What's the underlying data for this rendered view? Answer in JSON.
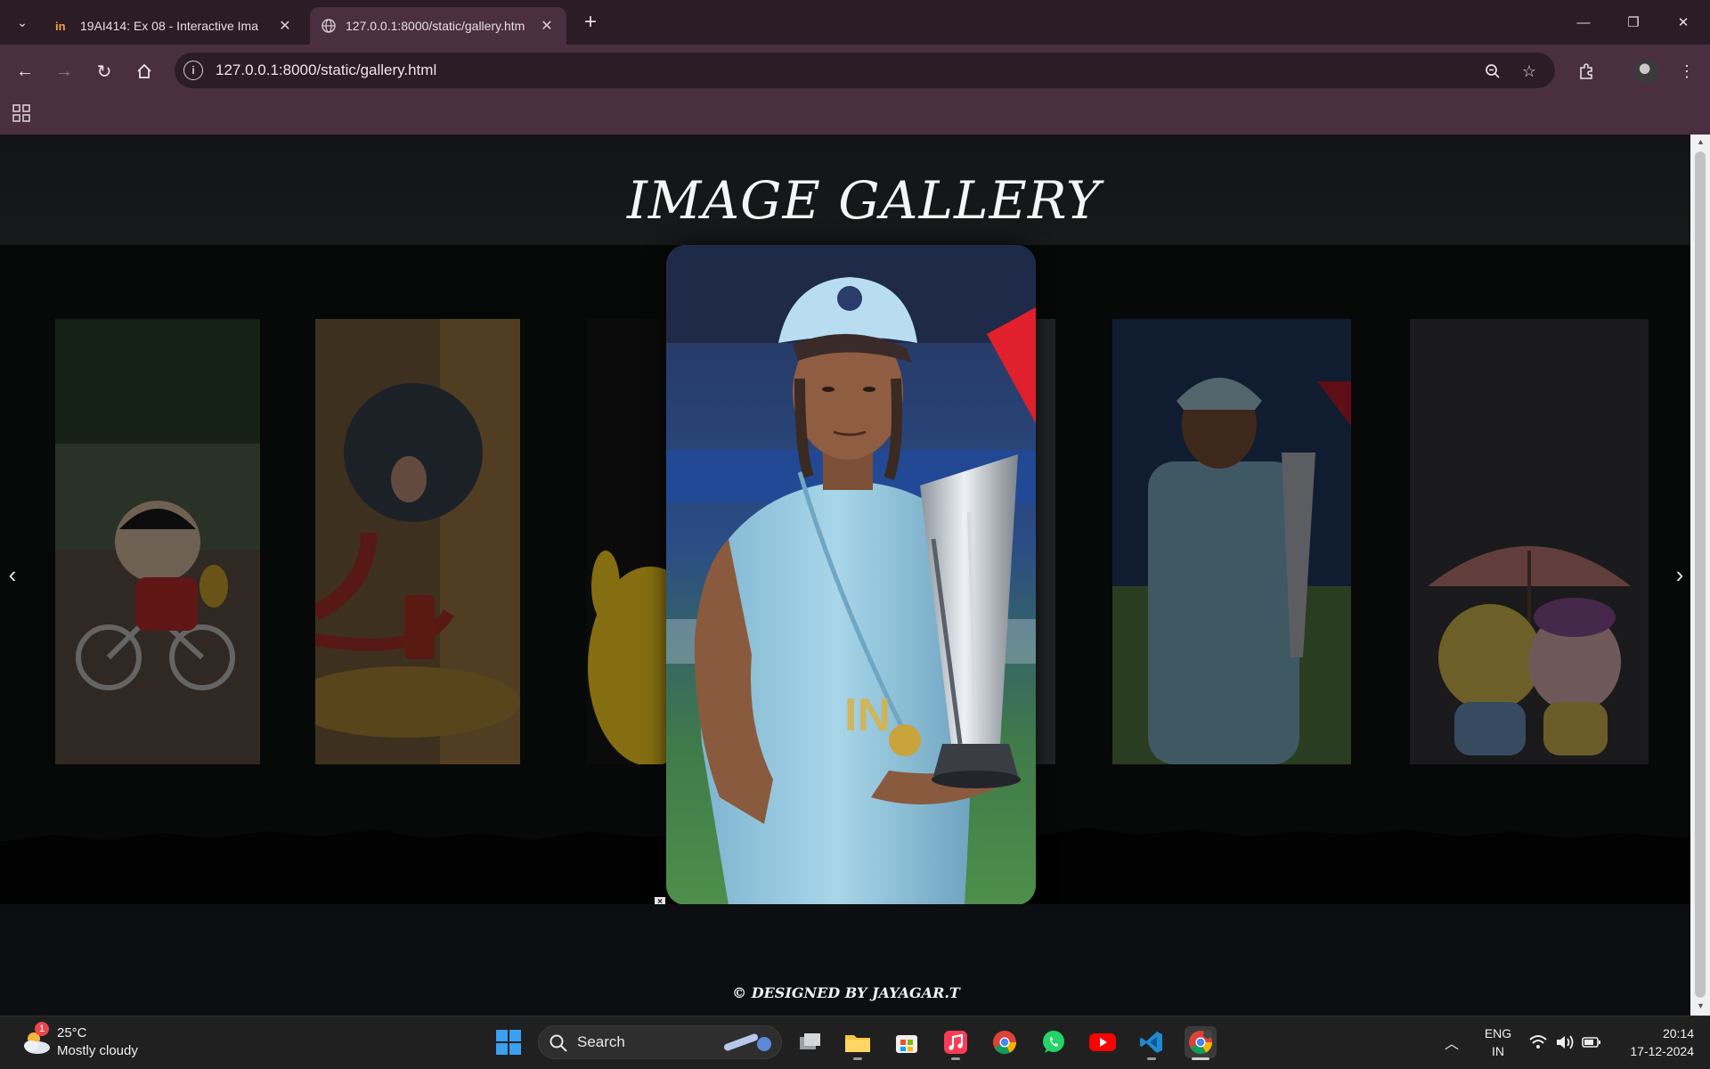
{
  "browser": {
    "tabs": [
      {
        "title": "19AI414: Ex 08 - Interactive Ima",
        "active": false
      },
      {
        "title": "127.0.0.1:8000/static/gallery.htm",
        "active": true
      }
    ],
    "new_tab_label": "+",
    "address": "127.0.0.1:8000/static/gallery.html",
    "window_controls": {
      "minimize": "—",
      "restore": "❐",
      "close": "✕"
    }
  },
  "page": {
    "title": "IMAGE GALLERY",
    "prev_arrow": "‹",
    "next_arrow": "›",
    "close_glyph": "×",
    "footer": "© DESIGNED BY JAYAGAR.T",
    "images": [
      {
        "name": "shinchan-bicycle",
        "featured": false
      },
      {
        "name": "tom-cat-hydrant",
        "featured": false
      },
      {
        "name": "pikachu",
        "featured": false
      },
      {
        "name": "dhoni-trophy",
        "featured": true
      },
      {
        "name": "dhoni-trophy",
        "featured": false
      },
      {
        "name": "cartoon-umbrella-rain",
        "featured": false
      }
    ]
  },
  "taskbar": {
    "weather": {
      "badge": "1",
      "temp": "25°C",
      "condition": "Mostly cloudy"
    },
    "search_label": "Search",
    "apps": [
      "task-view",
      "file-explorer",
      "microsoft-store",
      "apple-music",
      "chrome",
      "whatsapp",
      "youtube",
      "vscode",
      "chrome-profile"
    ],
    "lang_line1": "ENG",
    "lang_line2": "IN",
    "time": "20:14",
    "date": "17-12-2024"
  },
  "colors": {
    "tabbar": "#2b1c26",
    "toolbar": "#4a2f41",
    "page_bg": "#0e0f10",
    "taskbar": "#202020"
  }
}
